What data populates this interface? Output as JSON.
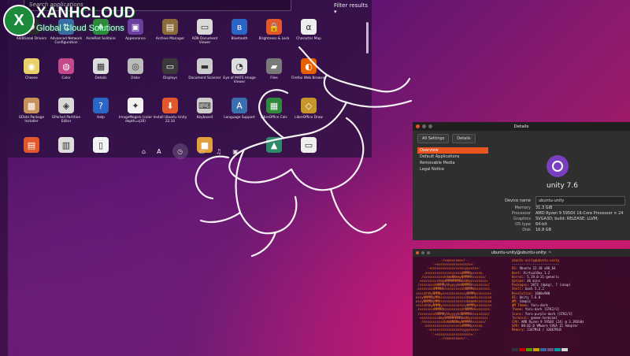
{
  "brand": {
    "name": "XANHCLOUD",
    "tagline": "Global Cloud Solutions",
    "mark": "X"
  },
  "dash": {
    "search_placeholder": "Search applications",
    "filter_label": "Filter results",
    "apps": [
      {
        "label": "Additional Drivers",
        "icon": "drivers-icon",
        "glyph": "⚙",
        "color": "#2a2a2a"
      },
      {
        "label": "Advanced Network Configuration",
        "icon": "network-icon",
        "glyph": "⇅",
        "color": "#3c6ea8"
      },
      {
        "label": "AisleRiot Solitaire",
        "icon": "cards-icon",
        "glyph": "♠",
        "color": "#2f8a3c"
      },
      {
        "label": "Appearance",
        "icon": "appearance-icon",
        "glyph": "▣",
        "color": "#6a3fa0"
      },
      {
        "label": "Archive Manager",
        "icon": "archive-icon",
        "glyph": "▤",
        "color": "#8c6b3a"
      },
      {
        "label": "AD8 Document Viewer",
        "icon": "document-viewer-icon",
        "glyph": "▭",
        "color": "#d9d9d9"
      },
      {
        "label": "Bluetooth",
        "icon": "bluetooth-icon",
        "glyph": "ʙ",
        "color": "#2b66c6"
      },
      {
        "label": "Brightness & Lock",
        "icon": "lock-icon",
        "glyph": "🔒",
        "color": "#e2572b"
      },
      {
        "label": "Character Map",
        "icon": "charmap-icon",
        "glyph": "α",
        "color": "#eeeeee"
      },
      {
        "label": "",
        "icon": "blank-icon",
        "glyph": "",
        "color": "transparent"
      },
      {
        "label": "Cheese",
        "icon": "cheese-icon",
        "glyph": "◉",
        "color": "#e9d06a"
      },
      {
        "label": "Color",
        "icon": "color-icon",
        "glyph": "◍",
        "color": "#c24a8a"
      },
      {
        "label": "Details",
        "icon": "details-icon",
        "glyph": "▦",
        "color": "#dddddd"
      },
      {
        "label": "Disks",
        "icon": "disks-icon",
        "glyph": "◎",
        "color": "#bbbbbb"
      },
      {
        "label": "Displays",
        "icon": "displays-icon",
        "glyph": "▭",
        "color": "#3a3a3a"
      },
      {
        "label": "Document Scanner",
        "icon": "scanner-icon",
        "glyph": "▬",
        "color": "#cccccc"
      },
      {
        "label": "Eye of MATE Image Viewer",
        "icon": "image-viewer-icon",
        "glyph": "◔",
        "color": "#dddddd"
      },
      {
        "label": "Files",
        "icon": "files-icon",
        "glyph": "▰",
        "color": "#7a7a7a"
      },
      {
        "label": "Firefox Web Browser",
        "icon": "firefox-icon",
        "glyph": "◐",
        "color": "#e66000"
      },
      {
        "label": "",
        "icon": "blank-icon",
        "glyph": "",
        "color": "transparent"
      },
      {
        "label": "GDebi Package Installer",
        "icon": "gdebi-icon",
        "glyph": "▩",
        "color": "#c8915a"
      },
      {
        "label": "GParted Partition Editor",
        "icon": "gparted-icon",
        "glyph": "◈",
        "color": "#d8d8d8"
      },
      {
        "label": "Help",
        "icon": "help-icon",
        "glyph": "?",
        "color": "#2b66c6"
      },
      {
        "label": "ImageMagick (color depth=q16)",
        "icon": "imagemagick-icon",
        "glyph": "✦",
        "color": "#f2f2f2"
      },
      {
        "label": "Install Ubuntu Unity 22.10",
        "icon": "installer-icon",
        "glyph": "⬇",
        "color": "#e2572b"
      },
      {
        "label": "Keyboard",
        "icon": "keyboard-icon",
        "glyph": "⌨",
        "color": "#cccccc"
      },
      {
        "label": "Language Support",
        "icon": "language-icon",
        "glyph": "A",
        "color": "#3a6fb0"
      },
      {
        "label": "LibreOffice Calc",
        "icon": "calc-icon",
        "glyph": "▦",
        "color": "#2f8a3c"
      },
      {
        "label": "LibreOffice Draw",
        "icon": "draw-icon",
        "glyph": "◇",
        "color": "#c8952b"
      },
      {
        "label": "",
        "icon": "blank-icon",
        "glyph": "",
        "color": "transparent"
      },
      {
        "label": "",
        "icon": "libreoffice-icon",
        "glyph": "▤",
        "color": "#e2572b"
      },
      {
        "label": "",
        "icon": "text-editor-icon",
        "glyph": "▥",
        "color": "#dddddd"
      },
      {
        "label": "",
        "icon": "document-icon",
        "glyph": "▯",
        "color": "#f2f2f2"
      },
      {
        "label": "",
        "icon": "blank-icon",
        "glyph": "",
        "color": "transparent"
      },
      {
        "label": "",
        "icon": "blank-icon",
        "glyph": "",
        "color": "transparent"
      },
      {
        "label": "",
        "icon": "media-icon",
        "glyph": "■",
        "color": "#e2a03a"
      },
      {
        "label": "",
        "icon": "blank-icon",
        "glyph": "",
        "color": "transparent"
      },
      {
        "label": "",
        "icon": "landscape-icon",
        "glyph": "▲",
        "color": "#2f8a6a"
      },
      {
        "label": "",
        "icon": "drive-icon",
        "glyph": "▭",
        "color": "#eeeeee"
      },
      {
        "label": "",
        "icon": "blank-icon",
        "glyph": "",
        "color": "transparent"
      }
    ],
    "lenses": [
      {
        "icon": "home-icon",
        "glyph": "⌂"
      },
      {
        "icon": "applications-icon",
        "glyph": "A"
      },
      {
        "icon": "files-lens-icon",
        "glyph": "◷"
      },
      {
        "icon": "video-lens-icon",
        "glyph": "▭"
      },
      {
        "icon": "music-lens-icon",
        "glyph": "♫"
      },
      {
        "icon": "photos-lens-icon",
        "glyph": "▣"
      }
    ]
  },
  "details_window": {
    "title": "Details",
    "tabs": [
      "All Settings",
      "Details"
    ],
    "sidebar": [
      "Overview",
      "Default Applications",
      "Removable Media",
      "Legal Notice"
    ],
    "product": "unity 7.6",
    "device_name_label": "Device name",
    "device_name": "ubuntu-unity",
    "info": [
      {
        "k": "Memory",
        "v": "31.3 GiB"
      },
      {
        "k": "Processor",
        "v": "AMD Ryzen 9 5950X 16-Core Processor × 24"
      },
      {
        "k": "Graphics",
        "v": "SVGA3D; build: RELEASE; LLVM;"
      },
      {
        "k": "OS type",
        "v": "64-bit"
      },
      {
        "k": "Disk",
        "v": "16.8 GB"
      }
    ]
  },
  "terminal": {
    "title": "ubuntu-unity@ubuntu-unity: ~",
    "art": "            .-/+oossssoo+/-.\n        `:+ssssssssssssssssss+:`\n      -+ssssssssssssssssssyyssss+-\n    .ossssssssssssssssssdMMMNysssso.\n   /ssssssssssshdmmNNmmyNMMMMhssssss/\n  +ssssssssshmydMMMMMMMNddddyssssssss+\n /sssssssshNMMMyhhyyyyhmNMMMNhssssssss/\n.ssssssssdMMMNhsssssssssshNMMMdssssssss.\n+sssshhhyNMMNyssssssssssssyNMMMysssssss+\nossyNMMMNyMMhsssssssssssssshmmmhssssssso\nossyNMMMNyMMhsssssssssssssshmmmhssssssso\n+sssshhhyNMMNyssssssssssssyNMMMysssssss+\n.ssssssssdMMMNhsssssssssshNMMMdssssssss.\n /sssssssshNMMMyhhyyyyhdNMMMNhssssssss/\n  +sssssssssdmydMMMMMMMMddddyssssssss+\n   /ssssssssssshdmNNNNmyNMMMMhssssss/\n    .ossssssssssssssssssdMMMNysssso.\n      -+sssssssssssssssssyyyssss+-\n        `:+ssssssssssssssssss+:`\n            .-/+oossssoo+/-.",
    "user_host": "ubuntu-unity@ubuntu-unity",
    "separator": "-------------------------",
    "rows": [
      {
        "k": "OS",
        "v": ": Ubuntu 22.10 x86_64"
      },
      {
        "k": "Host",
        "v": ": VirtualBox 1.2"
      },
      {
        "k": "Kernel",
        "v": ": 5.19.0-21-generic"
      },
      {
        "k": "Uptime",
        "v": ": 46 mins"
      },
      {
        "k": "Packages",
        "v": ": 2073 (dpkg), 7 (snap)"
      },
      {
        "k": "Shell",
        "v": ": bash 5.2.2"
      },
      {
        "k": "Resolution",
        "v": ": 1600x900"
      },
      {
        "k": "DE",
        "v": ": Unity 7.6.0"
      },
      {
        "k": "WM",
        "v": ": Compiz"
      },
      {
        "k": "WM Theme",
        "v": ": Yaru-dark"
      },
      {
        "k": "Theme",
        "v": ": Yaru-dark [GTK2/3]"
      },
      {
        "k": "Icons",
        "v": ": Yaru-purple-dark [GTK2/3]"
      },
      {
        "k": "Terminal",
        "v": ": gnome-terminal"
      },
      {
        "k": "CPU",
        "v": ": AMD Ryzen 9 5950X (24) @ 3.393GHz"
      },
      {
        "k": "GPU",
        "v": ": 00:02.0 VMware SVGA II Adapter"
      },
      {
        "k": "Memory",
        "v": ": 2347MiB / 32067MiB"
      }
    ],
    "palette": [
      "#2e3436",
      "#cc0000",
      "#4e9a06",
      "#c4a000",
      "#3465a4",
      "#75507b",
      "#06989a",
      "#d3d7cf"
    ]
  }
}
